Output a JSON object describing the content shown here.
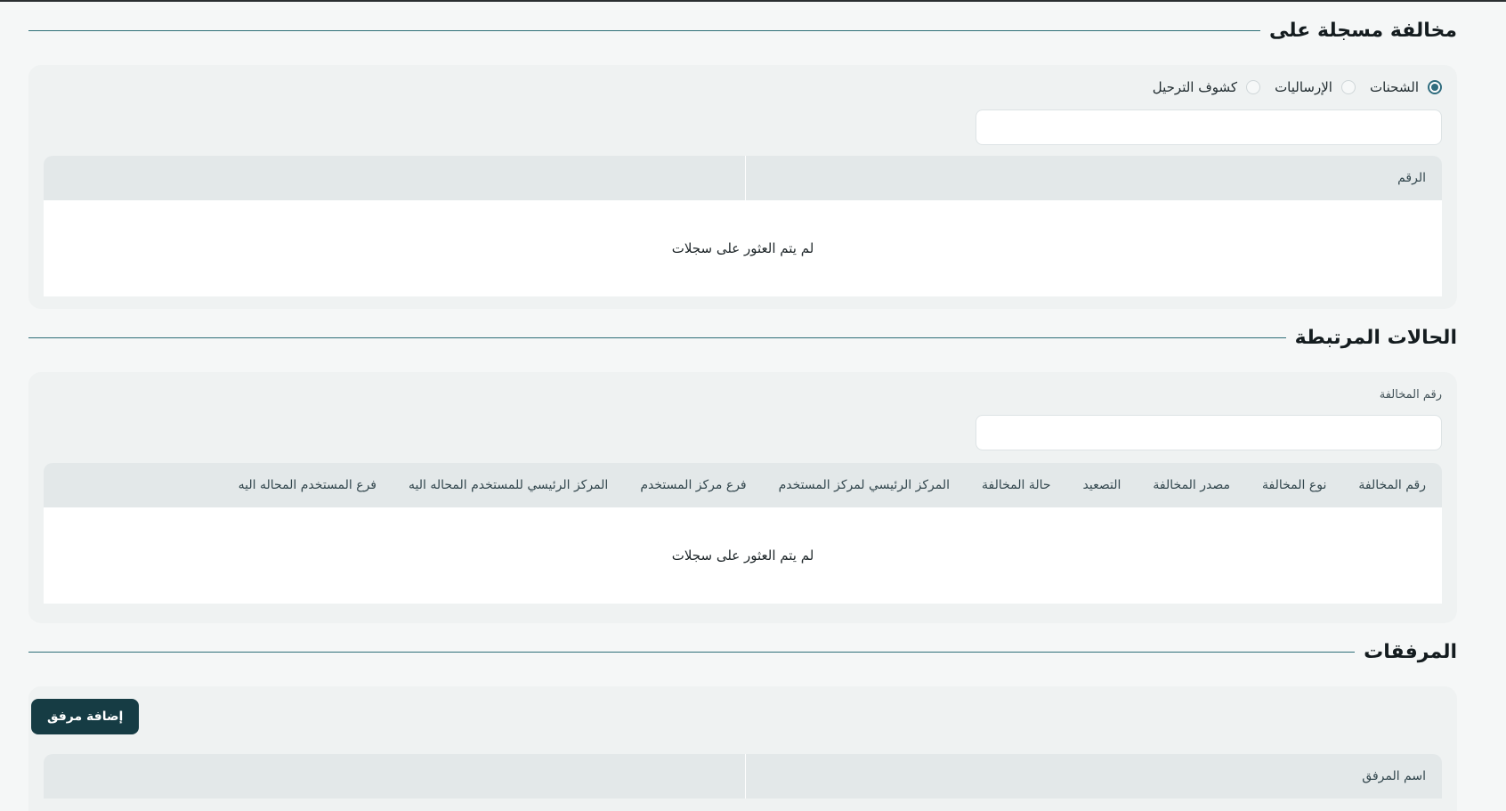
{
  "violation_registered_on": {
    "title": "مخالفة مسجلة على",
    "radio_options": [
      {
        "label": "الشحنات",
        "checked": true
      },
      {
        "label": "الإرساليات",
        "checked": false
      },
      {
        "label": "كشوف الترحيل",
        "checked": false
      }
    ],
    "search_value": "",
    "table": {
      "columns": [
        "الرقم",
        ""
      ],
      "empty_message": "لم يتم العثور على سجلات"
    }
  },
  "related_cases": {
    "title": "الحالات المرتبطة",
    "violation_number_label": "رقم المخالفة",
    "violation_number_value": "",
    "table": {
      "columns": [
        "رقم المخالفة",
        "نوع المخالفة",
        "مصدر المخالفة",
        "التصعيد",
        "حالة المخالفة",
        "المركز الرئيسي لمركز المستخدم",
        "فرع مركز المستخدم",
        "المركز الرئيسي للمستخدم المحاله اليه",
        "فرع المستخدم المحاله اليه"
      ],
      "empty_message": "لم يتم العثور على سجلات"
    }
  },
  "attachments": {
    "title": "المرفقات",
    "add_button": "إضافة مرفق",
    "table": {
      "columns": [
        "اسم المرفق",
        ""
      ]
    }
  },
  "colors": {
    "accent": "#2f6c7e",
    "button": "#163c44",
    "card_bg": "#eff2f2",
    "header_bg": "#e3e8e9"
  }
}
